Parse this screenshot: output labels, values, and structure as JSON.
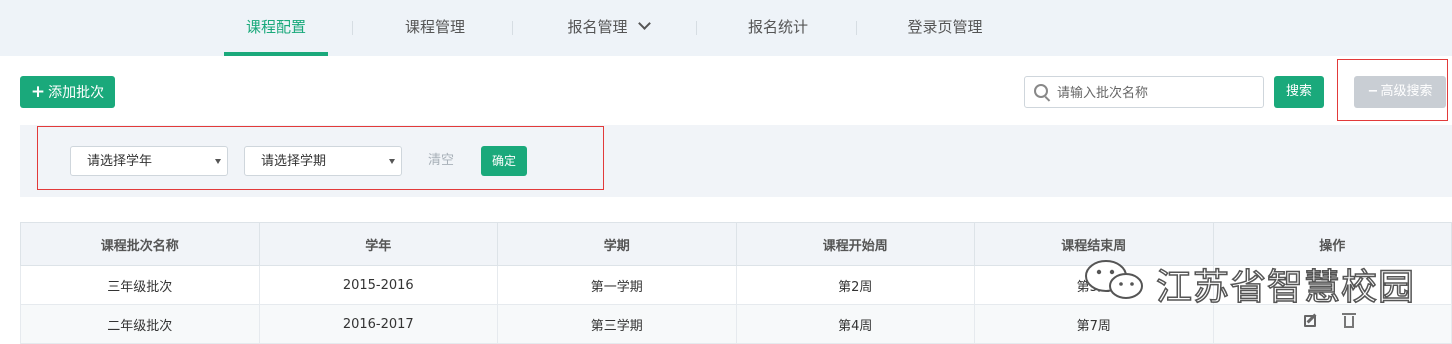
{
  "nav": {
    "items": [
      {
        "label": "课程配置",
        "active": true
      },
      {
        "label": "课程管理",
        "active": false
      },
      {
        "label": "报名管理",
        "active": false,
        "dropdown": true
      },
      {
        "label": "报名统计",
        "active": false
      },
      {
        "label": "登录页管理",
        "active": false
      }
    ]
  },
  "toolbar": {
    "add_label": "添加批次",
    "search_placeholder": "请输入批次名称",
    "search_label": "搜索",
    "advanced_label": "高级搜索",
    "advanced_icon": "minus-icon"
  },
  "filter": {
    "year_select": "请选择学年",
    "term_select": "请选择学期",
    "clear_label": "清空",
    "confirm_label": "确定"
  },
  "table": {
    "headers": [
      "课程批次名称",
      "学年",
      "学期",
      "课程开始周",
      "课程结束周",
      "操作"
    ],
    "rows": [
      [
        "三年级批次",
        "2015-2016",
        "第一学期",
        "第2周",
        "第5周"
      ],
      [
        "二年级批次",
        "2016-2017",
        "第三学期",
        "第4周",
        "第7周"
      ]
    ]
  },
  "watermark": {
    "text": "江苏省智慧校园"
  },
  "colors": {
    "accent": "#1aa97b",
    "highlight_frame": "#e23a3a",
    "disabled": "#c9ced4"
  }
}
